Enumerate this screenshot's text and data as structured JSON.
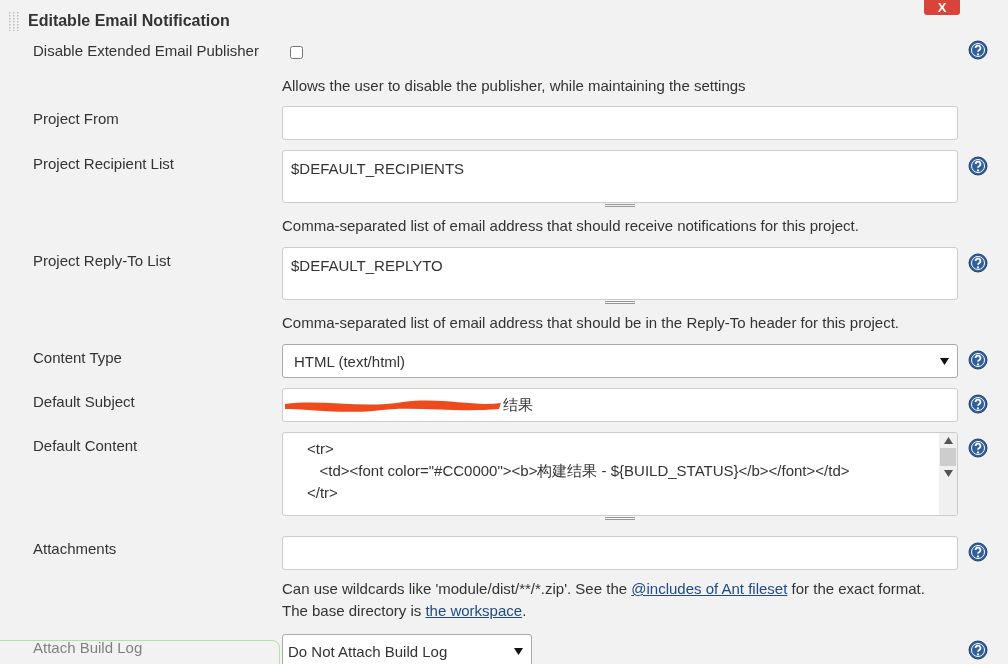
{
  "section": {
    "title": "Editable Email Notification",
    "delete_button": {
      "label": "X"
    }
  },
  "fields": [
    {
      "kind": "checkbox",
      "label": "Disable Extended Email Publisher",
      "checked": false,
      "help": true,
      "description": [
        "Allows the user to disable the publisher, while maintaining the settings"
      ]
    },
    {
      "kind": "text",
      "label": "Project From",
      "help": false
    },
    {
      "kind": "textarea",
      "label": "Project Recipient List",
      "value": [
        "$DEFAULT_RECIPIENTS"
      ],
      "help": true,
      "description": [
        "Comma-separated list of email address that should receive notifications for this project."
      ]
    },
    {
      "kind": "textarea",
      "label": "Project Reply-To List",
      "value": [
        "$DEFAULT_REPLYTO"
      ],
      "help": true,
      "description": [
        "Comma-separated list of email address that should be in the Reply-To header for this project."
      ]
    },
    {
      "kind": "select",
      "label": "Content Type",
      "value": "HTML (text/html)",
      "help": true,
      "wide": true
    },
    {
      "kind": "redacted",
      "label": "Default Subject",
      "value": "结果",
      "help": true
    },
    {
      "kind": "code",
      "label": "Default Content",
      "value": [
        "<tr>",
        "   <td><font color=\"#CC0000\"><b>构建结果 - ${BUILD_STATUS}</b></font></td>",
        "</tr>"
      ],
      "help": true
    },
    {
      "kind": "text",
      "label": "Attachments",
      "help": true,
      "description": [
        "Can use wildcards like 'module/dist/**/*.zip'. See the ",
        "@includes of Ant fileset",
        " for the exact format.",
        "The base directory is ",
        "the workspace",
        "."
      ]
    },
    {
      "kind": "select",
      "label": "Attach Build Log",
      "value": "Do Not Attach Build Log",
      "help": true,
      "wide": false
    }
  ]
}
